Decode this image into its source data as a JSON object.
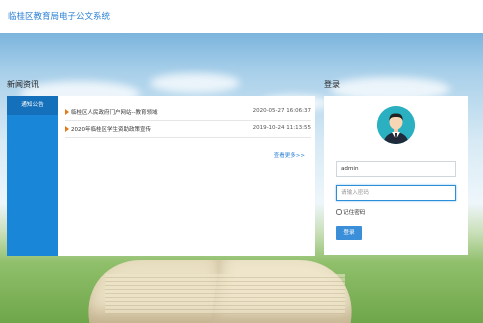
{
  "header": {
    "system_title": "临桂区教育局电子公文系统"
  },
  "news": {
    "section_title": "新闻资讯",
    "tab_label": "通知公告",
    "items": [
      {
        "title": "临桂区人民政府门户网站--教育领域",
        "date": "2020-05-27 16:06:37"
      },
      {
        "title": "2020年临桂区学生资助政策宣传",
        "date": "2019-10-24 11:13:55"
      }
    ],
    "more_label": "查看更多>>"
  },
  "login": {
    "section_title": "登录",
    "username_value": "admin",
    "password_placeholder": "请输入密码",
    "remember_label": "记住密码",
    "button_label": "登录"
  }
}
